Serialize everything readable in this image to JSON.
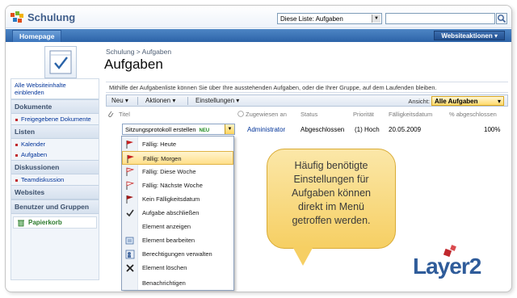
{
  "header": {
    "site_title": "Schulung",
    "scope_select": "Diese Liste: Aufgaben",
    "search_value": ""
  },
  "nav": {
    "home_tab": "Homepage",
    "site_actions": "Websiteaktionen"
  },
  "title_area": {
    "breadcrumb": "Schulung > Aufgaben",
    "page_title": "Aufgaben"
  },
  "sidebar": {
    "all_content": "Alle Websiteinhalte einblenden",
    "sections": [
      {
        "label": "Dokumente",
        "items": [
          "Freigegebene Dokumente"
        ]
      },
      {
        "label": "Listen",
        "items": [
          "Kalender",
          "Aufgaben"
        ]
      },
      {
        "label": "Diskussionen",
        "items": [
          "Teamdiskussion"
        ]
      },
      {
        "label": "Websites",
        "items": []
      },
      {
        "label": "Benutzer und Gruppen",
        "items": []
      }
    ],
    "recycle_bin": "Papierkorb"
  },
  "main": {
    "description": "Mithilfe der Aufgabenliste können Sie über Ihre ausstehenden Aufgaben, oder die Ihrer Gruppe, auf dem Laufenden bleiben.",
    "toolbar": {
      "new": "Neu",
      "actions": "Aktionen",
      "settings": "Einstellungen",
      "view_label": "Ansicht:",
      "view_value": "Alle Aufgaben"
    },
    "columns": [
      "Titel",
      "Zugewiesen an",
      "Status",
      "Priorität",
      "Fälligkeitsdatum",
      "% abgeschlossen"
    ],
    "row": {
      "title": "Sitzungsprotokoll erstellen",
      "new_badge": "NEU",
      "assigned": "Administrator",
      "status": "Abgeschlossen",
      "priority": "(1) Hoch",
      "due": "20.05.2009",
      "percent": "100%"
    }
  },
  "menu": {
    "items": [
      {
        "label": "Fällig: Heute",
        "icon": "red-flag-icon"
      },
      {
        "label": "Fällig: Morgen",
        "icon": "red-flag-icon",
        "highlighted": true
      },
      {
        "label": "Fällig: Diese Woche",
        "icon": "flag-outline-icon"
      },
      {
        "label": "Fällig: Nächste Woche",
        "icon": "flag-outline-icon"
      },
      {
        "label": "Kein Fälligkeitsdatum",
        "icon": "red-flag-icon"
      },
      {
        "label": "Aufgabe abschließen",
        "icon": "checkmark-icon"
      },
      {
        "label": "Element anzeigen",
        "icon": ""
      },
      {
        "label": "Element bearbeiten",
        "icon": "edit-icon"
      },
      {
        "label": "Berechtigungen verwalten",
        "icon": "permissions-icon"
      },
      {
        "label": "Element löschen",
        "icon": "delete-icon"
      },
      {
        "label": "Benachrichtigen",
        "icon": ""
      }
    ]
  },
  "callout": {
    "lines": [
      "Häufig benötigte",
      "Einstellungen für",
      "Aufgaben können",
      "direkt im Menü",
      "getroffen werden."
    ]
  },
  "brand": {
    "text": "Layer2",
    "color": "#2f5c9a",
    "accent": "#c0282d"
  }
}
